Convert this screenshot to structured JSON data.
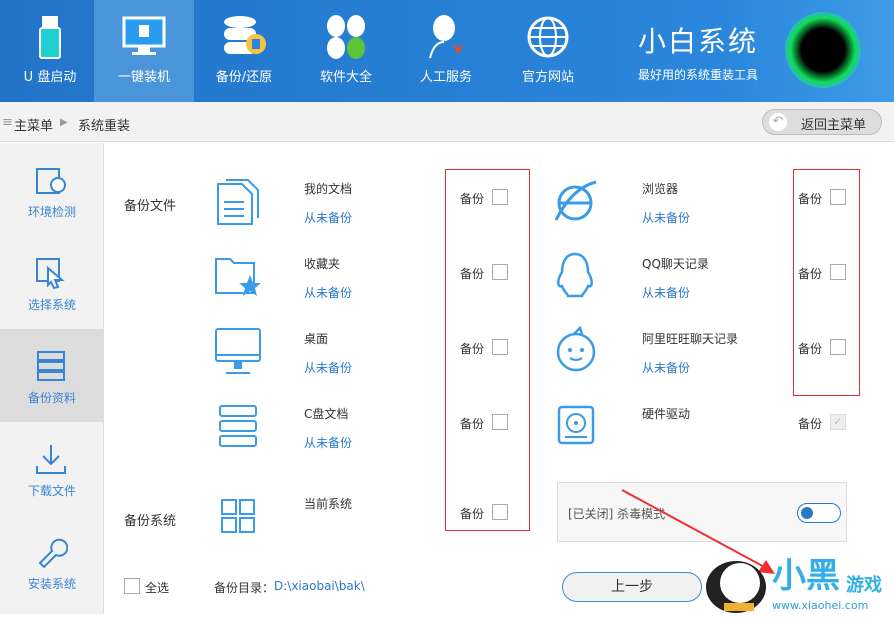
{
  "nav": [
    {
      "label": "U 盘启动"
    },
    {
      "label": "一键装机"
    },
    {
      "label": "备份/还原"
    },
    {
      "label": "软件大全"
    },
    {
      "label": "人工服务"
    },
    {
      "label": "官方网站"
    }
  ],
  "brand": {
    "title": "小白系统",
    "subtitle": "最好用的系统重装工具"
  },
  "breadcrumb": {
    "home": "主菜单",
    "current": "系统重装"
  },
  "back_button": "返回主菜单",
  "sidebar": [
    {
      "label": "环境检测"
    },
    {
      "label": "选择系统"
    },
    {
      "label": "备份资料"
    },
    {
      "label": "下载文件"
    },
    {
      "label": "安装系统"
    }
  ],
  "sections": {
    "files": "备份文件",
    "system": "备份系统"
  },
  "left_items": [
    {
      "name": "我的文档",
      "status": "从未备份",
      "check": "备份"
    },
    {
      "name": "收藏夹",
      "status": "从未备份",
      "check": "备份"
    },
    {
      "name": "桌面",
      "status": "从未备份",
      "check": "备份"
    },
    {
      "name": "C盘文档",
      "status": "从未备份",
      "check": "备份"
    },
    {
      "name": "当前系统",
      "check": "备份"
    }
  ],
  "right_items": [
    {
      "name": "浏览器",
      "status": "从未备份",
      "check": "备份"
    },
    {
      "name": "QQ聊天记录",
      "status": "从未备份",
      "check": "备份"
    },
    {
      "name": "阿里旺旺聊天记录",
      "status": "从未备份",
      "check": "备份"
    },
    {
      "name": "硬件驱动",
      "check": "备份"
    }
  ],
  "antivirus": {
    "label": "[已关闭] 杀毒模式",
    "enabled": false
  },
  "select_all": "全选",
  "backup_dir": {
    "label": "备份目录：",
    "path": "D:\\xiaobai\\bak\\"
  },
  "prev_button": "上一步",
  "watermark": {
    "text": "小黑游戏",
    "url": "www.xiaohei.com"
  }
}
